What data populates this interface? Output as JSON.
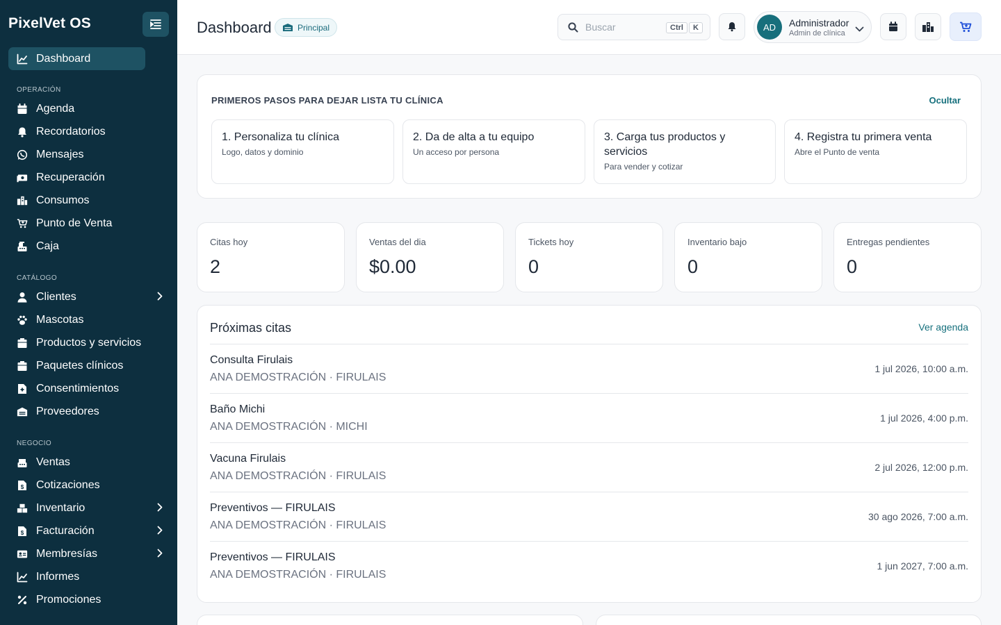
{
  "app": {
    "brand": "PixelVet OS"
  },
  "sidebar": {
    "dashboard": "Dashboard",
    "sections": {
      "operacion": "OPERACIÓN",
      "catalogo": "CATÁLOGO",
      "negocio": "NEGOCIO"
    },
    "items": {
      "agenda": "Agenda",
      "recordatorios": "Recordatorios",
      "mensajes": "Mensajes",
      "recuperacion": "Recuperación",
      "consumos": "Consumos",
      "punto_venta": "Punto de Venta",
      "caja": "Caja",
      "clientes": "Clientes",
      "mascotas": "Mascotas",
      "productos": "Productos y servicios",
      "paquetes": "Paquetes clínicos",
      "consentimientos": "Consentimientos",
      "proveedores": "Proveedores",
      "ventas": "Ventas",
      "cotizaciones": "Cotizaciones",
      "inventario": "Inventario",
      "facturacion": "Facturación",
      "membresias": "Membresías",
      "informes": "Informes",
      "promociones": "Promociones"
    }
  },
  "header": {
    "title": "Dashboard",
    "branch": "Principal",
    "search_placeholder": "Buscar",
    "kbd_ctrl": "Ctrl",
    "kbd_k": "K",
    "user_initials": "AD",
    "user_name": "Administrador",
    "user_role": "Admin de clínica"
  },
  "onboarding": {
    "title": "PRIMEROS PASOS PARA DEJAR LISTA TU CLÍNICA",
    "hide": "Ocultar",
    "steps": [
      {
        "title": "1. Personaliza tu clínica",
        "sub": "Logo, datos y dominio"
      },
      {
        "title": "2. Da de alta a tu equipo",
        "sub": "Un acceso por persona"
      },
      {
        "title": "3. Carga tus productos y servicios",
        "sub": "Para vender y cotizar"
      },
      {
        "title": "4. Registra tu primera venta",
        "sub": "Abre el Punto de venta"
      }
    ]
  },
  "stats": [
    {
      "label": "Citas hoy",
      "value": "2"
    },
    {
      "label": "Ventas del dia",
      "value": "$0.00"
    },
    {
      "label": "Tickets hoy",
      "value": "0"
    },
    {
      "label": "Inventario bajo",
      "value": "0"
    },
    {
      "label": "Entregas pendientes",
      "value": "0"
    }
  ],
  "appointments": {
    "title": "Próximas citas",
    "link": "Ver agenda",
    "rows": [
      {
        "name": "Consulta Firulais",
        "sub": "ANA DEMOSTRACIÓN · FIRULAIS",
        "date": "1 jul 2026, 10:00 a.m."
      },
      {
        "name": "Baño Michi",
        "sub": "ANA DEMOSTRACIÓN · MICHI",
        "date": "1 jul 2026, 4:00 p.m."
      },
      {
        "name": "Vacuna Firulais",
        "sub": "ANA DEMOSTRACIÓN · FIRULAIS",
        "date": "2 jul 2026, 12:00 p.m."
      },
      {
        "name": "Preventivos — FIRULAIS",
        "sub": "ANA DEMOSTRACIÓN · FIRULAIS",
        "date": "30 ago 2026, 7:00 a.m."
      },
      {
        "name": "Preventivos — FIRULAIS",
        "sub": "ANA DEMOSTRACIÓN · FIRULAIS",
        "date": "1 jun 2027, 7:00 a.m."
      }
    ]
  },
  "colors": {
    "sidebar_bg": "#0d2f3f",
    "sidebar_active": "#1e5263",
    "accent": "#16707d",
    "avatar": "#176f7c"
  }
}
